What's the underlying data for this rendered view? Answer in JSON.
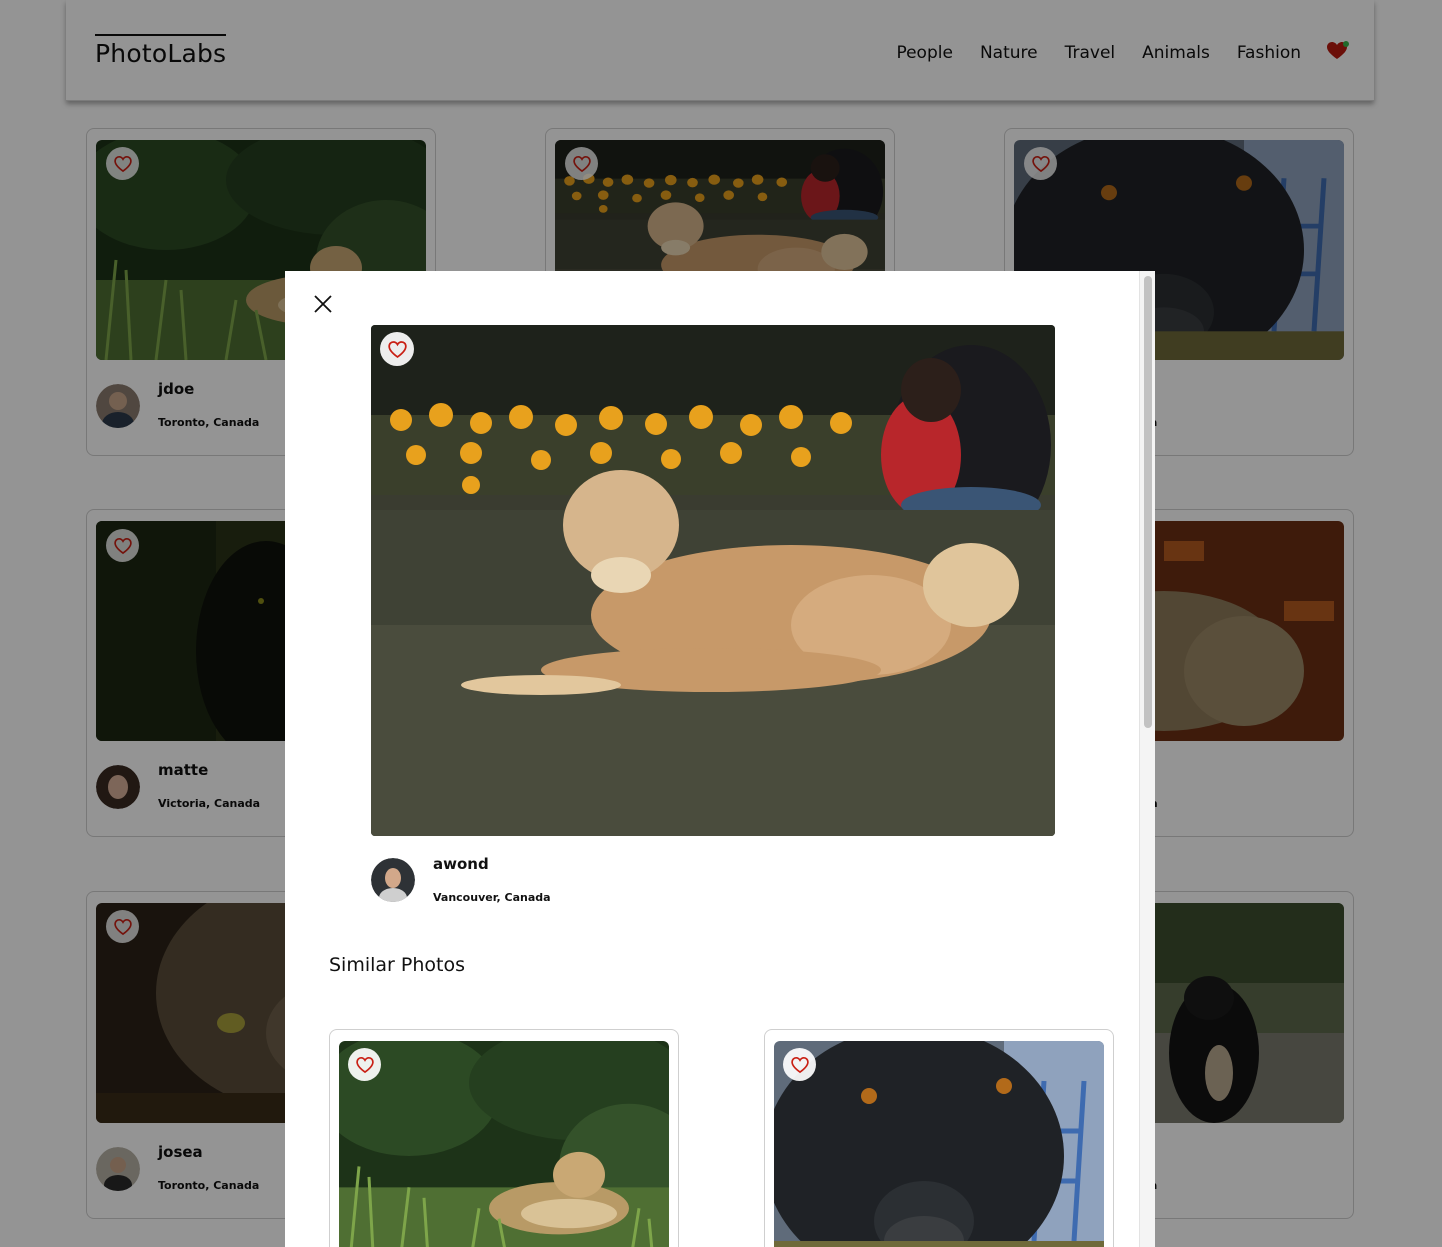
{
  "app": {
    "logo": "PhotoLabs"
  },
  "nav": {
    "topics": [
      "People",
      "Nature",
      "Travel",
      "Animals",
      "Fashion"
    ],
    "fav_icon": "heart-icon"
  },
  "grid": [
    {
      "username": "jdoe",
      "location": "Toronto, Canada",
      "subject": "jaguar"
    },
    {
      "username": "",
      "location": "",
      "subject": "dog-in-field"
    },
    {
      "username": "",
      "location": "da",
      "subject": "black-dog"
    },
    {
      "username": "matte",
      "location": "Victoria, Canada",
      "subject": "black-cat"
    },
    {
      "username": "",
      "location": "",
      "subject": ""
    },
    {
      "username": "",
      "location": "ada",
      "subject": "tabby-cat"
    },
    {
      "username": "josea",
      "location": "Toronto, Canada",
      "subject": "tabby-cat-close"
    },
    {
      "username": "",
      "location": "",
      "subject": ""
    },
    {
      "username": "",
      "location": "da",
      "subject": "puppy"
    }
  ],
  "modal": {
    "close_icon": "close-icon",
    "fav_icon": "heart-icon",
    "username": "awond",
    "location": "Vancouver, Canada",
    "similar_title": "Similar Photos",
    "similar": [
      {
        "subject": "jaguar"
      },
      {
        "subject": "black-dog"
      }
    ]
  },
  "colors": {
    "heart": "#c91f14",
    "overlay": "rgba(0,0,0,0.42)"
  }
}
